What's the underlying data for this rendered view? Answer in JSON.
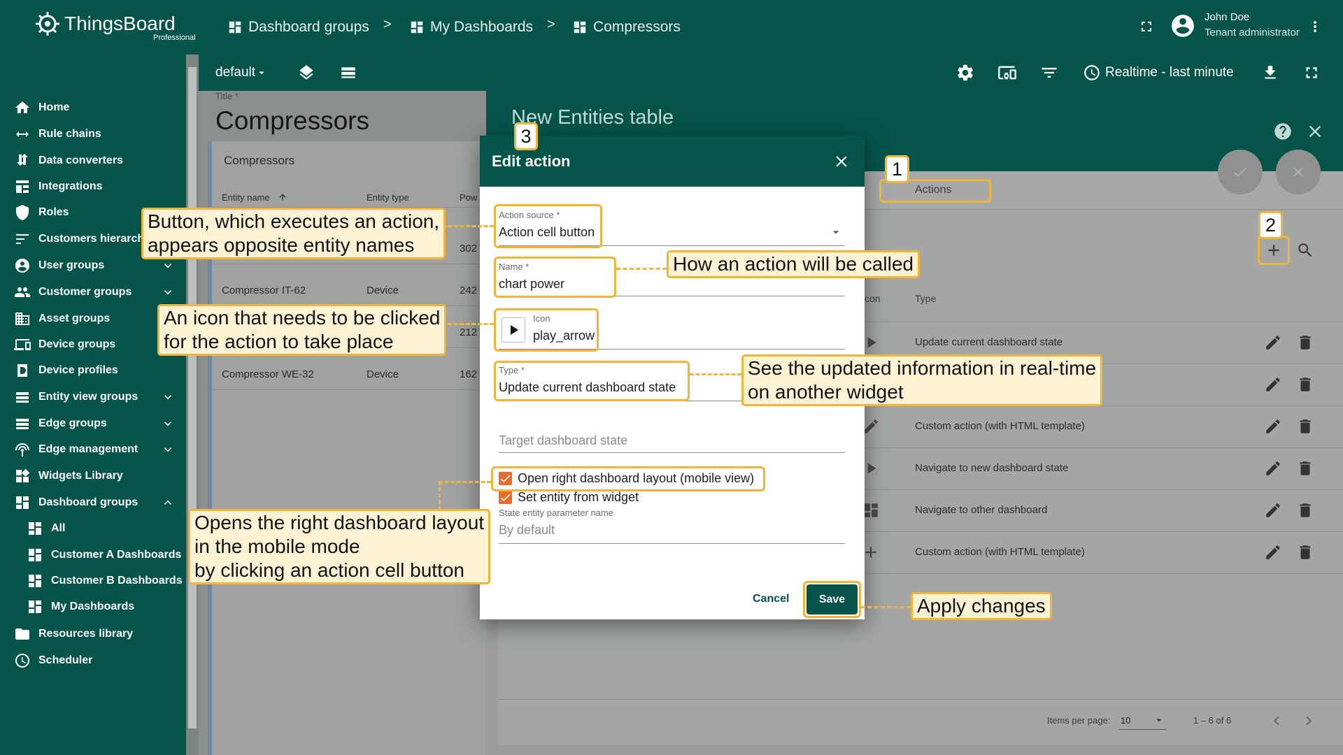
{
  "app": {
    "name": "ThingsBoard",
    "edition": "Professional"
  },
  "breadcrumb": [
    {
      "label": "Dashboard groups",
      "icon": "dashboard-grid-icon"
    },
    {
      "label": "My Dashboards",
      "icon": "dashboard-grid-icon"
    },
    {
      "label": "Compressors",
      "icon": "dashboard-grid-icon"
    }
  ],
  "breadcrumb_separator": ">",
  "user": {
    "name": "John Doe",
    "role": "Tenant administrator"
  },
  "sidebar": {
    "items": [
      {
        "label": "Home",
        "icon": "home-icon"
      },
      {
        "label": "Rule chains",
        "icon": "rule-chain-icon"
      },
      {
        "label": "Data converters",
        "icon": "converter-icon"
      },
      {
        "label": "Integrations",
        "icon": "integration-icon"
      },
      {
        "label": "Roles",
        "icon": "shield-icon"
      },
      {
        "label": "Customers hierarchy",
        "icon": "hierarchy-icon"
      },
      {
        "label": "User groups",
        "icon": "user-icon",
        "expandable": true
      },
      {
        "label": "Customer groups",
        "icon": "group-icon",
        "expandable": true
      },
      {
        "label": "Asset groups",
        "icon": "building-icon"
      },
      {
        "label": "Device groups",
        "icon": "device-icon",
        "expandable": true
      },
      {
        "label": "Device profiles",
        "icon": "profile-icon"
      },
      {
        "label": "Entity view groups",
        "icon": "view-icon",
        "expandable": true
      },
      {
        "label": "Edge groups",
        "icon": "edge-icon",
        "expandable": true
      },
      {
        "label": "Edge management",
        "icon": "antenna-icon",
        "expandable": true
      },
      {
        "label": "Widgets Library",
        "icon": "widgets-icon"
      },
      {
        "label": "Dashboard groups",
        "icon": "dashboard-grid-icon",
        "expanded": true
      },
      {
        "label": "All",
        "icon": "dashboard-grid-icon",
        "sub": true
      },
      {
        "label": "Customer A Dashboards",
        "icon": "dashboard-grid-icon",
        "sub": true
      },
      {
        "label": "Customer B Dashboards",
        "icon": "dashboard-grid-icon",
        "sub": true
      },
      {
        "label": "My Dashboards",
        "icon": "dashboard-grid-icon",
        "sub": true
      },
      {
        "label": "Resources library",
        "icon": "folder-icon"
      },
      {
        "label": "Scheduler",
        "icon": "clock-icon"
      }
    ]
  },
  "toolbar": {
    "state": "default",
    "time_window": "Realtime - last minute"
  },
  "dashboard": {
    "title_label": "Title *",
    "title": "Compressors",
    "widget": {
      "title": "Compressors",
      "columns": [
        "Entity name",
        "Entity type",
        "Pow"
      ],
      "rows": [
        {
          "name": "",
          "type": "",
          "power": "302"
        },
        {
          "name": "Compressor IT-62",
          "type": "Device",
          "power": "242"
        },
        {
          "name": "",
          "type": "",
          "power": "212"
        },
        {
          "name": "Compressor WE-32",
          "type": "Device",
          "power": "162"
        }
      ]
    }
  },
  "panel": {
    "title": "New Entities table",
    "tab": "Actions",
    "columns": [
      "con",
      "Type"
    ],
    "rows": [
      {
        "type": "Update current dashboard state",
        "icon": "play-icon"
      },
      {
        "type": "",
        "icon": ""
      },
      {
        "type": "Custom action (with HTML template)",
        "icon": "edit-icon"
      },
      {
        "type": "Navigate to new dashboard state",
        "icon": "play-icon"
      },
      {
        "type": "Navigate to other dashboard",
        "icon": "dashboard-grid-icon"
      },
      {
        "type": "Custom action (with HTML template)",
        "icon": "plus-icon"
      }
    ],
    "pagination": {
      "items_per_page_label": "Items per page:",
      "items_per_page": "10",
      "range": "1 – 6 of 6"
    }
  },
  "dialog": {
    "title": "Edit action",
    "action_source_label": "Action source *",
    "action_source": "Action cell button",
    "name_label": "Name *",
    "name": "chart power",
    "icon_label": "Icon",
    "icon": "play_arrow",
    "type_label": "Type *",
    "type": "Update current dashboard state",
    "target_state_placeholder": "Target dashboard state",
    "open_right_layout": "Open right dashboard layout (mobile view)",
    "set_entity": "Set entity from widget",
    "state_entity_param_label": "State entity parameter name",
    "state_entity_param_placeholder": "By default",
    "cancel": "Cancel",
    "save": "Save"
  },
  "annotations": {
    "num1": "1",
    "num2": "2",
    "num3": "3",
    "button_line1": "Button, which executes an action,",
    "button_line2": "appears opposite entity names",
    "name_callout": "How an action will be called",
    "icon_line1": "An icon that needs to be clicked",
    "icon_line2": "for the action to take place",
    "type_line1": "See the updated information in real-time",
    "type_line2": "on another widget",
    "layout_line1": "Opens the right dashboard layout",
    "layout_line2": "in the mobile mode",
    "layout_line3": "by clicking an action cell button",
    "apply_callout": "Apply changes"
  },
  "colors": {
    "brand": "#05544a",
    "accent": "#ea6b2e",
    "callout_border": "#f2b53b",
    "callout_bg": "#fdf3d4"
  }
}
